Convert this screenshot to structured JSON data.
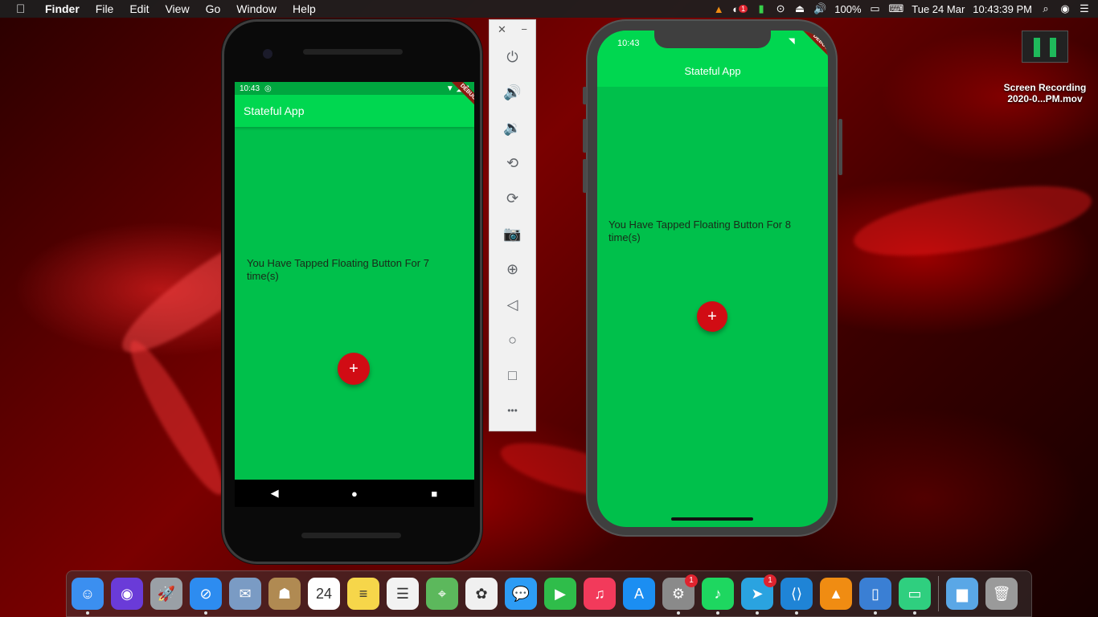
{
  "menubar": {
    "app_name": "Finder",
    "menus": [
      "File",
      "Edit",
      "View",
      "Go",
      "Window",
      "Help"
    ],
    "notification_badge": "1",
    "battery": "100%",
    "date": "Tue 24 Mar",
    "time": "10:43:39 PM"
  },
  "desktop": {
    "file_name_line1": "Screen Recording",
    "file_name_line2": "2020-0...PM.mov"
  },
  "android": {
    "status_time": "10:43",
    "app_title": "Stateful App",
    "debug_label": "DEBUG",
    "message": "You Have Tapped Floating Button For 7 time(s)",
    "fab_label": "+",
    "nav": {
      "back": "◀",
      "home": "●",
      "recents": "■"
    }
  },
  "emulator_toolbar": {
    "close": "✕",
    "minimize": "−",
    "buttons": [
      {
        "name": "power-icon",
        "glyph": "⏻"
      },
      {
        "name": "volume-up-icon",
        "glyph": "🔊"
      },
      {
        "name": "volume-down-icon",
        "glyph": "🔉"
      },
      {
        "name": "rotate-left-icon",
        "glyph": "⟲"
      },
      {
        "name": "rotate-right-icon",
        "glyph": "⟳"
      },
      {
        "name": "camera-icon",
        "glyph": "📷"
      },
      {
        "name": "zoom-icon",
        "glyph": "⊕"
      },
      {
        "name": "back-icon",
        "glyph": "◁"
      },
      {
        "name": "home-icon",
        "glyph": "○"
      },
      {
        "name": "overview-icon",
        "glyph": "□"
      },
      {
        "name": "more-icon",
        "glyph": "•••"
      }
    ]
  },
  "ios": {
    "status_time": "10:43",
    "app_title": "Stateful App",
    "debug_label": "DEBUG",
    "message": "You Have Tapped Floating Button For 8 time(s)",
    "fab_label": "+"
  },
  "dock": {
    "apps": [
      {
        "name": "finder",
        "glyph": "☺",
        "color": "#3b8ff0",
        "running": true
      },
      {
        "name": "siri",
        "glyph": "◉",
        "color": "#6a3bd8",
        "running": false
      },
      {
        "name": "launchpad",
        "glyph": "🚀",
        "color": "#9aa0a6",
        "running": false
      },
      {
        "name": "safari",
        "glyph": "⊘",
        "color": "#2d8cf0",
        "running": true
      },
      {
        "name": "mail",
        "glyph": "✉",
        "color": "#7a9bc4",
        "running": false
      },
      {
        "name": "contacts",
        "glyph": "☗",
        "color": "#b08a52",
        "running": false
      },
      {
        "name": "calendar",
        "glyph": "24",
        "color": "#ffffff",
        "running": false
      },
      {
        "name": "notes",
        "glyph": "≡",
        "color": "#f6d64a",
        "running": false
      },
      {
        "name": "reminders",
        "glyph": "☰",
        "color": "#f2f2f2",
        "running": false
      },
      {
        "name": "maps",
        "glyph": "⌖",
        "color": "#5cb85c",
        "running": false
      },
      {
        "name": "photos",
        "glyph": "✿",
        "color": "#f0f0f0",
        "running": false
      },
      {
        "name": "messages",
        "glyph": "💬",
        "color": "#2d9cf5",
        "running": false
      },
      {
        "name": "facetime",
        "glyph": "▶",
        "color": "#2fbd4a",
        "running": false
      },
      {
        "name": "music",
        "glyph": "♫",
        "color": "#f23a5b",
        "running": false
      },
      {
        "name": "app-store",
        "glyph": "A",
        "color": "#1b8ef2",
        "running": false
      },
      {
        "name": "system-preferences",
        "glyph": "⚙",
        "color": "#8a8a8a",
        "running": true,
        "badge": "1"
      },
      {
        "name": "spotify",
        "glyph": "♪",
        "color": "#1ed760",
        "running": true
      },
      {
        "name": "telegram",
        "glyph": "➤",
        "color": "#2aa3e0",
        "running": true,
        "badge": "1"
      },
      {
        "name": "vscode",
        "glyph": "⟨⟩",
        "color": "#1f84d6",
        "running": true
      },
      {
        "name": "vlc",
        "glyph": "▲",
        "color": "#f08c12",
        "running": false
      },
      {
        "name": "simulator",
        "glyph": "▯",
        "color": "#3a7fd4",
        "running": true
      },
      {
        "name": "android-studio-emulator",
        "glyph": "▭",
        "color": "#2fcf7f",
        "running": true
      }
    ],
    "right": [
      {
        "name": "downloads-folder",
        "glyph": "▆",
        "color": "#5aa7e6"
      },
      {
        "name": "trash",
        "glyph": "🗑",
        "color": "#9a9a9a"
      }
    ]
  }
}
